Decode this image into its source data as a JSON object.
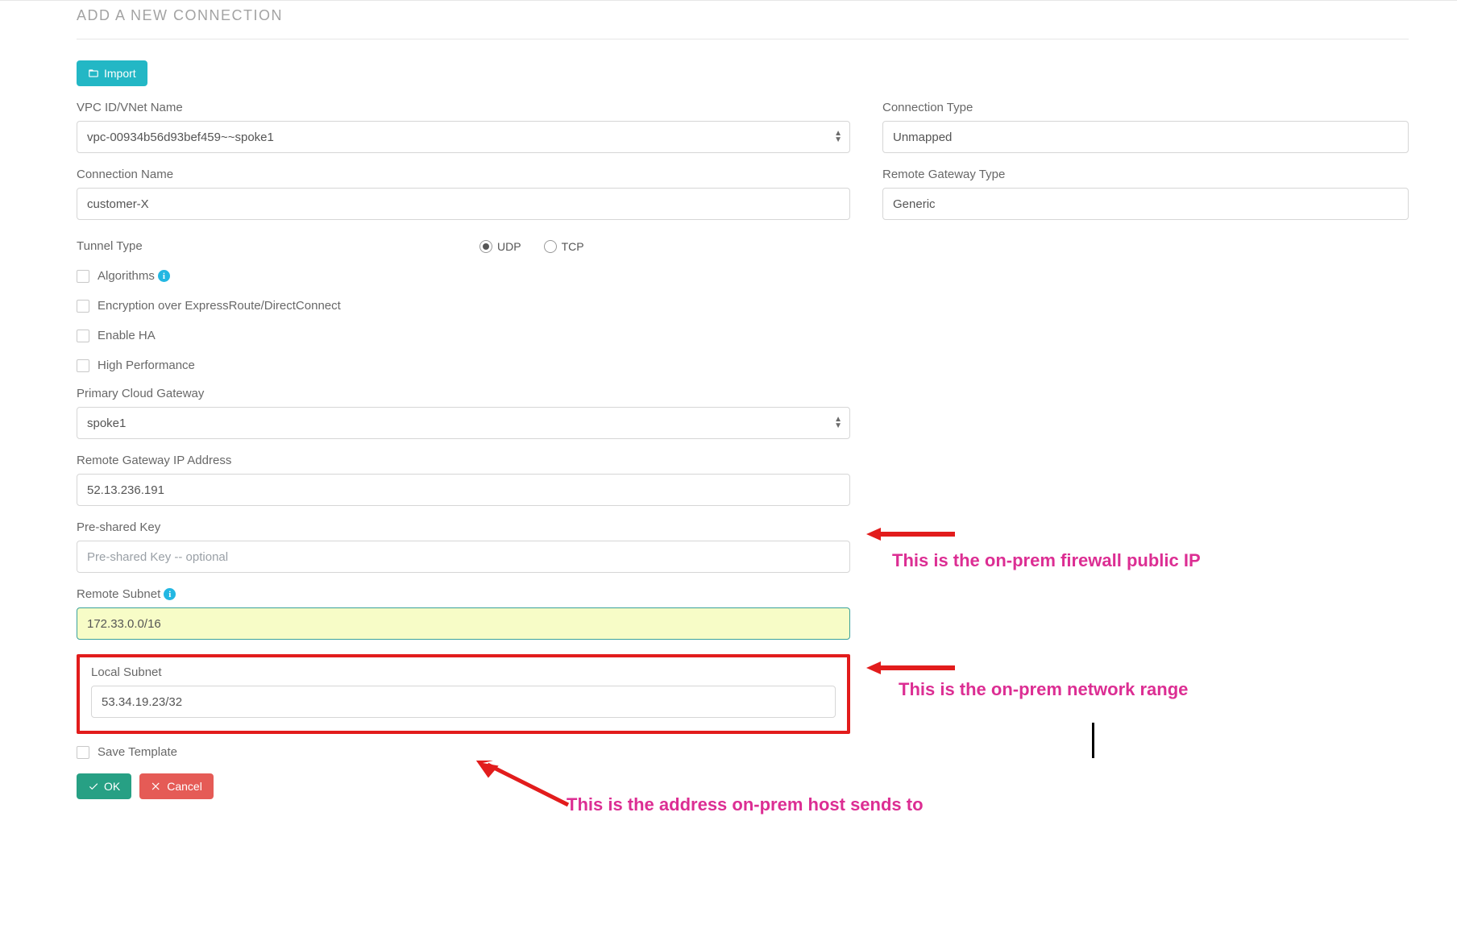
{
  "heading": "ADD A NEW CONNECTION",
  "buttons": {
    "import": "Import",
    "ok": "OK",
    "cancel": "Cancel"
  },
  "labels": {
    "vpc": "VPC ID/VNet Name",
    "conn_type": "Connection Type",
    "conn_name": "Connection Name",
    "remote_gw_type": "Remote Gateway Type",
    "tunnel_type": "Tunnel Type",
    "algorithms": "Algorithms",
    "encryption_er": "Encryption over ExpressRoute/DirectConnect",
    "enable_ha": "Enable HA",
    "high_perf": "High Performance",
    "primary_gw": "Primary Cloud Gateway",
    "remote_gw_ip": "Remote Gateway IP Address",
    "psk": "Pre-shared Key",
    "remote_subnet": "Remote Subnet",
    "local_subnet": "Local Subnet",
    "save_template": "Save Template"
  },
  "values": {
    "vpc": "vpc-00934b56d93bef459~~spoke1",
    "conn_type": "Unmapped",
    "conn_name": "customer-X",
    "remote_gw_type": "Generic",
    "tunnel_udp": "UDP",
    "tunnel_tcp": "TCP",
    "primary_gw": "spoke1",
    "remote_gw_ip": "52.13.236.191",
    "psk_placeholder": "Pre-shared Key -- optional",
    "remote_subnet": "172.33.0.0/16",
    "local_subnet": "53.34.19.23/32"
  },
  "annotations": {
    "a1": "This is the on-prem firewall public IP",
    "a2": "This is the on-prem network range",
    "a3": "This is the address on-prem host sends to"
  }
}
